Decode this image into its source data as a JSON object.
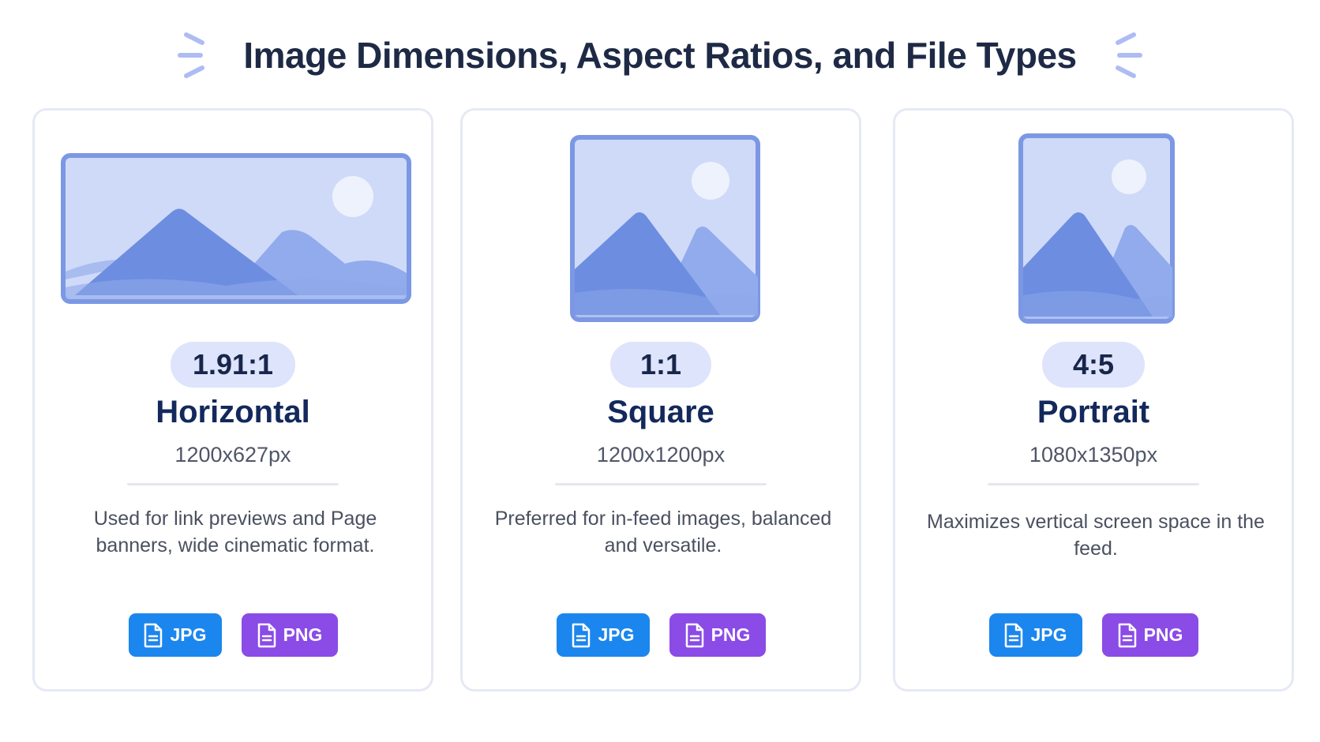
{
  "header": {
    "title": "Image Dimensions, Aspect Ratios, and File Types"
  },
  "colors": {
    "title": "#1e2a45",
    "card_border": "#e6e9f5",
    "ratio_pill": "#dde4fb",
    "format_name": "#13295c",
    "jpg_badge": "#1b86ee",
    "png_badge": "#8b4be6",
    "illustration_sky": "#cfdaf8",
    "illustration_mountain": "#6f8fe0"
  },
  "cards": [
    {
      "ratio": "1.91:1",
      "name": "Horizontal",
      "dimensions": "1200x627px",
      "description": "Used for link previews and Page banners, wide cinematic format.",
      "illustration": "landscape-image-icon",
      "file_types": [
        "JPG",
        "PNG"
      ]
    },
    {
      "ratio": "1:1",
      "name": "Square",
      "dimensions": "1200x1200px",
      "description": "Preferred for in-feed images, balanced and versatile.",
      "illustration": "square-image-icon",
      "file_types": [
        "JPG",
        "PNG"
      ]
    },
    {
      "ratio": "4:5",
      "name": "Portrait",
      "dimensions": "1080x1350px",
      "description": "Maximizes vertical screen space in the feed.",
      "illustration": "portrait-image-icon",
      "file_types": [
        "JPG",
        "PNG"
      ]
    }
  ]
}
